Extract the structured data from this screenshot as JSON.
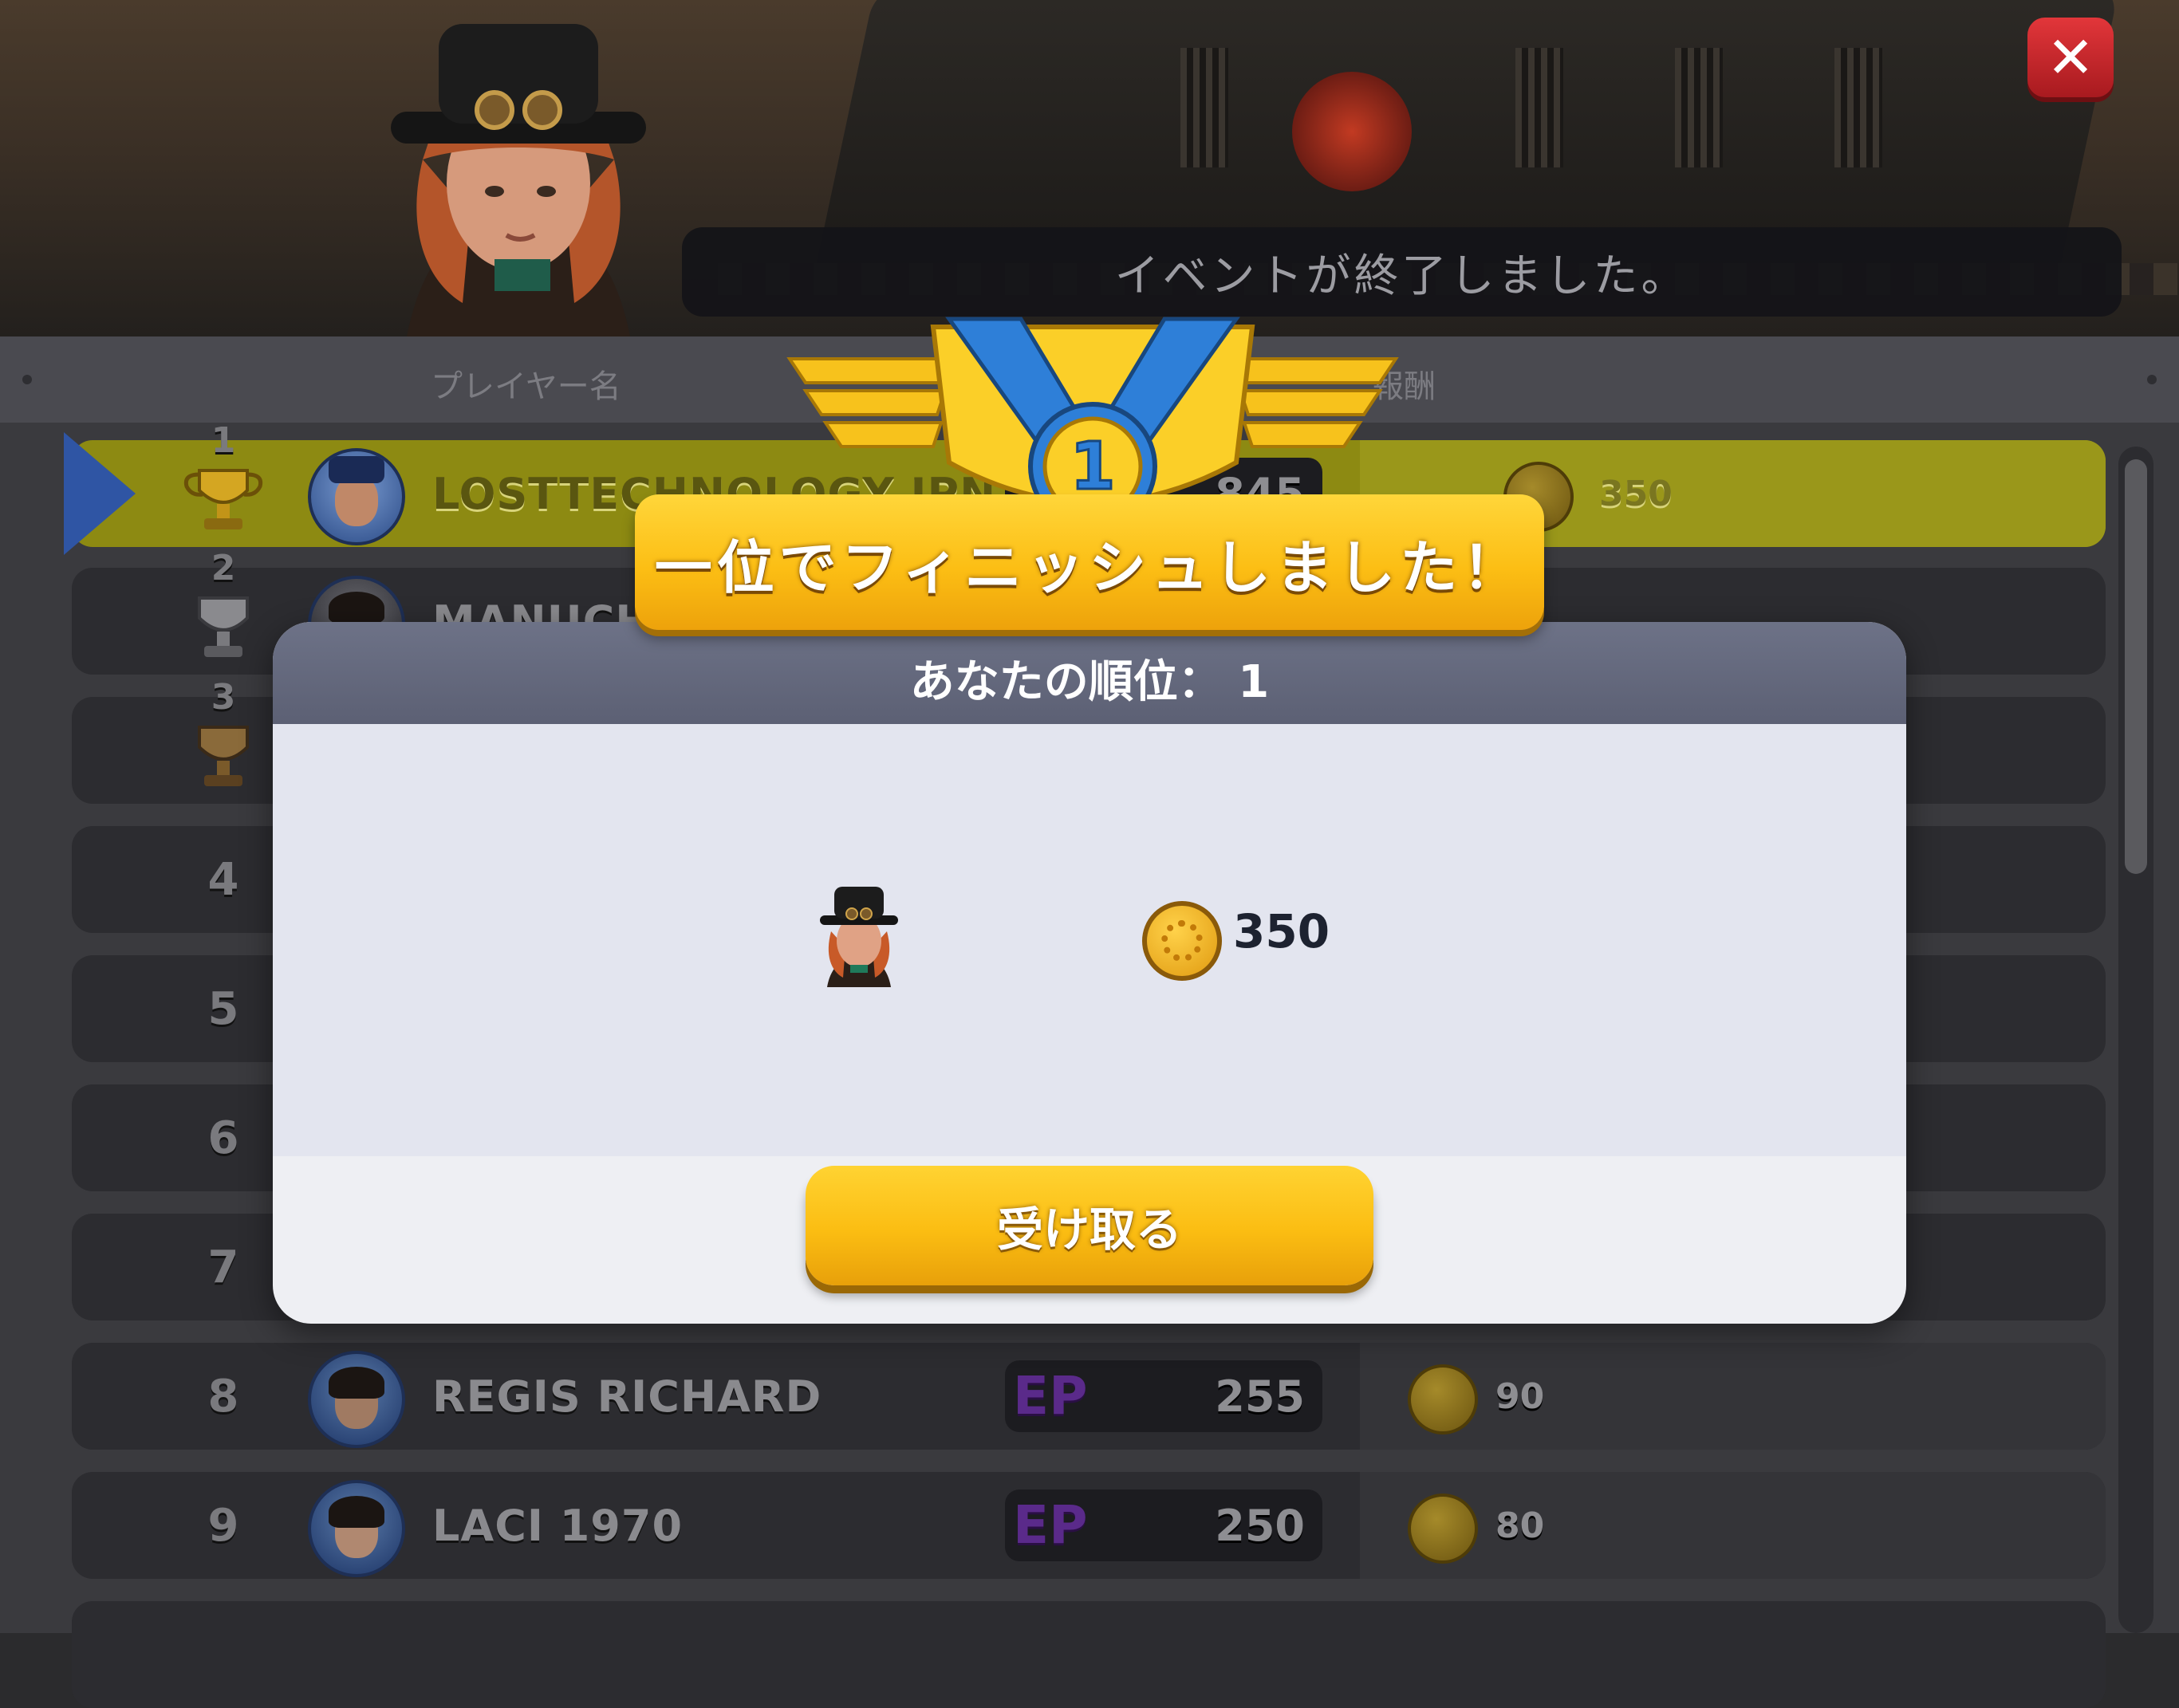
{
  "event_banner": "イベントが終了しました。",
  "close_icon": "close-icon",
  "board": {
    "header_name": "プレイヤー名",
    "header_reward": "報酬",
    "rows": [
      {
        "rank": "1",
        "name": "LOSTTECHNOLOGY JPN",
        "ep": "845",
        "reward": "350"
      },
      {
        "rank": "2",
        "name": "MANUCHO",
        "ep": "",
        "reward": ""
      },
      {
        "rank": "3",
        "name": "",
        "ep": "",
        "reward": ""
      },
      {
        "rank": "4",
        "name": "",
        "ep": "",
        "reward": ""
      },
      {
        "rank": "5",
        "name": "",
        "ep": "",
        "reward": ""
      },
      {
        "rank": "6",
        "name": "",
        "ep": "",
        "reward": ""
      },
      {
        "rank": "7",
        "name": "",
        "ep": "",
        "reward": ""
      },
      {
        "rank": "8",
        "name": "REGIS RICHARD",
        "ep": "255",
        "reward": "90"
      },
      {
        "rank": "9",
        "name": "LACI 1970",
        "ep": "250",
        "reward": "80"
      }
    ],
    "ep_label": "EP"
  },
  "finish_banner": "一位でフィニッシュしました！",
  "medal_rank": "1",
  "modal": {
    "title": "あなたの順位：",
    "rank": "1",
    "reward_amount": "350",
    "claim_label": "受け取る"
  },
  "colors": {
    "accent_gold": "#fbbd12",
    "highlight_row": "#8d8a12",
    "pointer_blue": "#2f55a4",
    "close_red": "#d32b30"
  }
}
